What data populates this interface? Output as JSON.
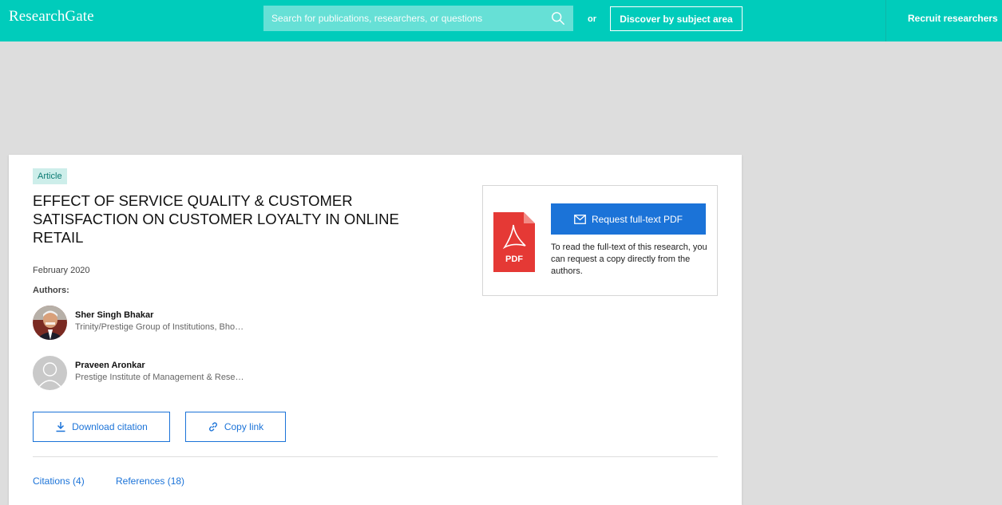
{
  "header": {
    "brand": "ResearchGate",
    "search_placeholder": "Search for publications, researchers, or questions",
    "or_label": "or",
    "discover_label": "Discover by subject area",
    "recruit_label": "Recruit researchers",
    "bar_color": "#00ccbb"
  },
  "article": {
    "type_badge": "Article",
    "title": "EFFECT OF SERVICE QUALITY & CUSTOMER SATISFACTION ON CUSTOMER LOYALTY IN ONLINE RETAIL",
    "date": "February 2020",
    "authors_label": "Authors:",
    "authors": [
      {
        "name": "Sher Singh Bhakar",
        "institution": "Trinity/Prestige Group of Institutions, Bho…"
      },
      {
        "name": "Praveen Aronkar",
        "institution": "Prestige Institute of Management & Rese…"
      }
    ],
    "actions": {
      "download_citation": "Download citation",
      "copy_link": "Copy link"
    },
    "tabs": [
      {
        "label": "Citations (4)"
      },
      {
        "label": "References (18)"
      }
    ]
  },
  "request_box": {
    "pdf_label": "PDF",
    "button_label": "Request full-text PDF",
    "description": "To read the full-text of this research, you can request a copy directly from the authors."
  },
  "colors": {
    "accent_blue": "#1b73d8",
    "pdf_red": "#e53935"
  }
}
